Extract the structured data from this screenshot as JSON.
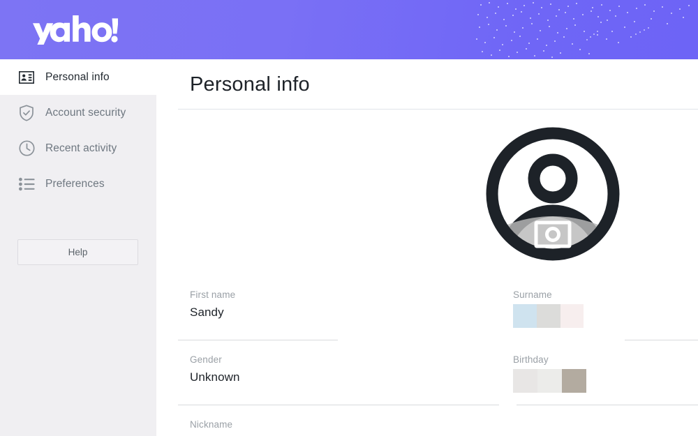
{
  "header": {
    "brand_name": "yahoo!",
    "brand_icon": "yahoo-wordmark",
    "gradient_from": "#7d74f4",
    "gradient_to": "#6d64f6",
    "decoration": "dot-constellation-pattern"
  },
  "sidebar": {
    "background": "#f0eff2",
    "items": [
      {
        "label": "Personal info",
        "icon": "id-card-icon",
        "active": true
      },
      {
        "label": "Account security",
        "icon": "shield-check-icon",
        "active": false
      },
      {
        "label": "Recent activity",
        "icon": "clock-icon",
        "active": false
      },
      {
        "label": "Preferences",
        "icon": "list-icon",
        "active": false
      }
    ],
    "help_label": "Help"
  },
  "main": {
    "title": "Personal info",
    "avatar": {
      "icon": "user-avatar-icon",
      "overlay_icon": "camera-icon",
      "outline_color": "#1d2228"
    },
    "fields": [
      {
        "label": "First name",
        "value": "Sandy",
        "state": "loaded"
      },
      {
        "label": "Surname",
        "value": "",
        "state": "unrendered",
        "blocks": [
          "#cfe3ef",
          "#dcdcda",
          "#f7eeee"
        ]
      },
      {
        "label": "Gender",
        "value": "Unknown",
        "state": "loaded"
      },
      {
        "label": "Birthday",
        "value": "",
        "state": "unrendered",
        "blocks": [
          "#e8e6e5",
          "#ececea",
          "#b3aba0"
        ]
      },
      {
        "label": "Nickname",
        "value": "",
        "state": "cut-off"
      }
    ]
  }
}
